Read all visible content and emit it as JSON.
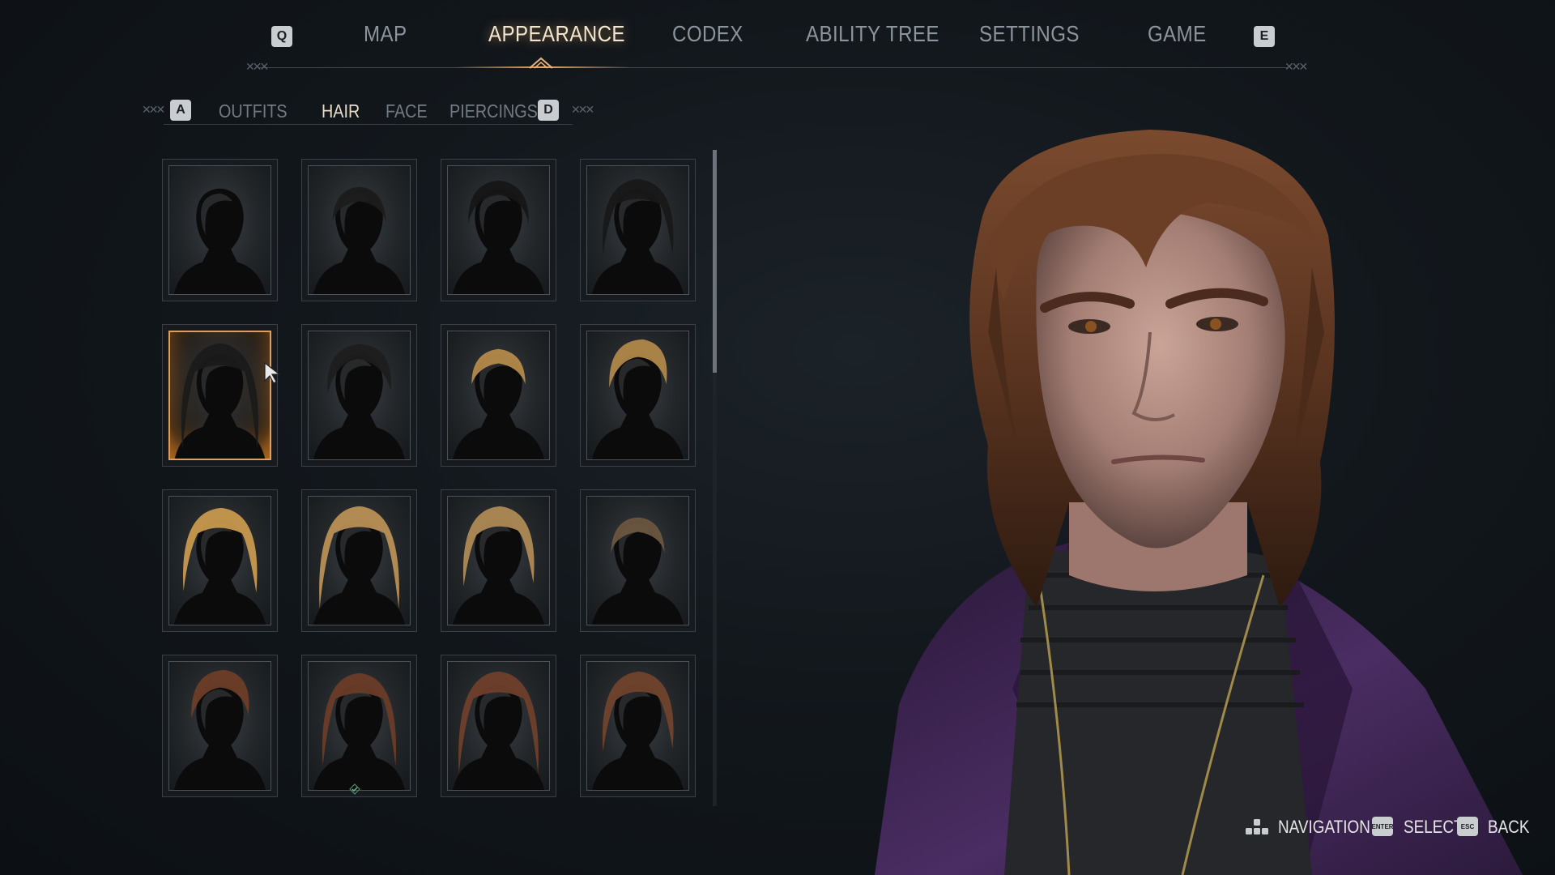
{
  "top_nav": {
    "prev_key": "Q",
    "next_key": "E",
    "tabs": [
      {
        "label": "MAP",
        "active": false
      },
      {
        "label": "APPEARANCE",
        "active": true
      },
      {
        "label": "CODEX",
        "active": false
      },
      {
        "label": "ABILITY TREE",
        "active": false
      },
      {
        "label": "SETTINGS",
        "active": false
      },
      {
        "label": "GAME",
        "active": false
      }
    ]
  },
  "sub_nav": {
    "prev_key": "A",
    "next_key": "D",
    "tabs": [
      {
        "label": "OUTFITS",
        "active": false
      },
      {
        "label": "HAIR",
        "active": true
      },
      {
        "label": "FACE",
        "active": false
      },
      {
        "label": "PIERCINGS",
        "active": false
      }
    ]
  },
  "hair_grid": {
    "columns": 4,
    "selected_index": 4,
    "equipped_index": 13,
    "items": [
      {
        "hair_color": "none",
        "style": "bald"
      },
      {
        "hair_color": "#1c1c1c",
        "style": "buzz"
      },
      {
        "hair_color": "#161616",
        "style": "short-tousled"
      },
      {
        "hair_color": "#181818",
        "style": "shaggy"
      },
      {
        "hair_color": "#1a1a1a",
        "style": "long-messy"
      },
      {
        "hair_color": "#1d1d1d",
        "style": "swept-short"
      },
      {
        "hair_color": "#b48a4a",
        "style": "short-crop"
      },
      {
        "hair_color": "#b0874a",
        "style": "quiff"
      },
      {
        "hair_color": "#c8994f",
        "style": "medium-wavy"
      },
      {
        "hair_color": "#b98f55",
        "style": "long-wavy"
      },
      {
        "hair_color": "#ad8a55",
        "style": "swept-medium"
      },
      {
        "hair_color": "#6d5640",
        "style": "buzz"
      },
      {
        "hair_color": "#6b3d27",
        "style": "quiff"
      },
      {
        "hair_color": "#6a3c28",
        "style": "mullet"
      },
      {
        "hair_color": "#6e3f2a",
        "style": "long-wavy"
      },
      {
        "hair_color": "#70432c",
        "style": "swept-medium"
      }
    ]
  },
  "hints": {
    "navigation_label": "NAVIGATION",
    "select_key": "ENTER",
    "select_label": "SELECT",
    "back_key": "ESC",
    "back_label": "BACK"
  },
  "colors": {
    "accent": "#d9a066",
    "active_text": "#f1e6d1",
    "inactive_text": "#8d959c",
    "background": "#12171c",
    "jacket": "#3b2350"
  }
}
